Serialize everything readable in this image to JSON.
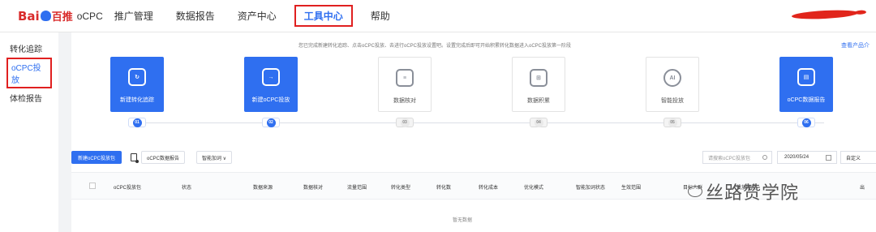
{
  "logo": {
    "brand_text_1": "Bai",
    "brand_text_2": "百推",
    "product": "oCPC"
  },
  "nav": {
    "items": [
      "推广管理",
      "数据报告",
      "资产中心",
      "工具中心",
      "帮助"
    ],
    "active_index": 3
  },
  "sidebar": {
    "items": [
      "转化追踪",
      "oCPC投放",
      "体检报告"
    ],
    "active_index": 1
  },
  "main": {
    "hint": "您已完成新建转化追踪、点击oCPC投放、去进行oCPC投放设置吧。设置完成后即可开始积累转化数据进入oCPC投放第一阶段",
    "view_link": "查看产品介",
    "steps": [
      {
        "label": "新建转化追踪",
        "num": "01",
        "state": "done",
        "icon": "conversion-track-icon"
      },
      {
        "label": "新建oCPC投放",
        "num": "02",
        "state": "done",
        "icon": "ocpc-new-icon"
      },
      {
        "label": "数据核对",
        "num": "03",
        "state": "todo",
        "icon": "data-check-icon"
      },
      {
        "label": "数据积累",
        "num": "04",
        "state": "todo",
        "icon": "data-accumulate-icon"
      },
      {
        "label": "智能投放",
        "num": "05",
        "state": "todo",
        "icon": "ai-icon"
      },
      {
        "label": "oCPC数据报告",
        "num": "06",
        "state": "done",
        "icon": "ocpc-report-icon"
      }
    ],
    "toolbar": {
      "new_button": "新建oCPC投放包",
      "report_button": "oCPC数据报告",
      "smart_button": "智能加词 ∨",
      "search_placeholder": "请搜索oCPC投放包",
      "date": "2020/05/24",
      "custom_button": "自定义"
    },
    "table": {
      "headers": [
        "oCPC投放包",
        "状态",
        "数据来源",
        "数据核对",
        "流量范围",
        "转化类型",
        "转化数",
        "转化成本",
        "优化模式",
        "智能加词状态",
        "生效范围",
        "目标人群",
        "投放时段",
        "出"
      ],
      "empty_text": "暂无数据"
    }
  },
  "watermark": {
    "text": "丝路赞学院"
  },
  "colors": {
    "accent": "#2f6ff0",
    "highlight_box": "#e02020",
    "redaction": "#e1251b"
  }
}
